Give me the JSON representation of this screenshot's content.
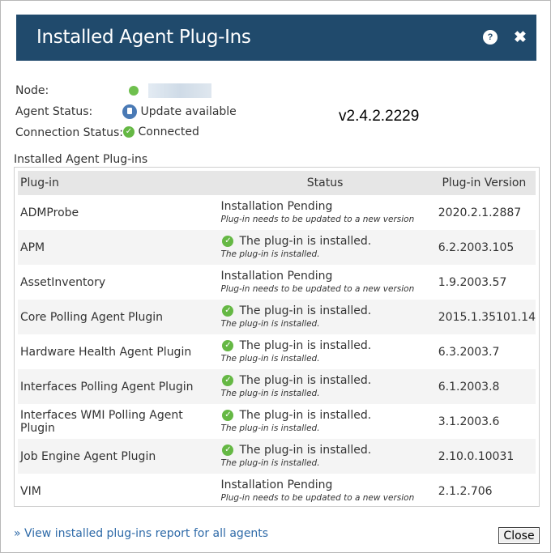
{
  "dialog": {
    "title": "Installed Agent Plug-Ins",
    "help_icon": "question-circle-icon",
    "close_icon": "close-x-icon"
  },
  "info": {
    "node_label": "Node:",
    "agent_status_label": "Agent Status:",
    "agent_status_value": "Update available",
    "connection_status_label": "Connection Status:",
    "connection_status_value": "Connected"
  },
  "version_text": "v2.4.2.2229",
  "section_title": "Installed Agent Plug-ins",
  "table": {
    "headers": [
      "Plug-in",
      "Status",
      "Plug-in Version"
    ],
    "rows": [
      {
        "plugin": "ADMProbe",
        "status": "Installation Pending",
        "status_sub": "Plug-in needs to be updated to a new version",
        "installed": false,
        "version": "2020.2.1.2887"
      },
      {
        "plugin": "APM",
        "status": "The plug-in is installed.",
        "status_sub": "The plug-in is installed.",
        "installed": true,
        "version": "6.2.2003.105"
      },
      {
        "plugin": "AssetInventory",
        "status": "Installation Pending",
        "status_sub": "Plug-in needs to be updated to a new version",
        "installed": false,
        "version": "1.9.2003.57"
      },
      {
        "plugin": "Core Polling Agent Plugin",
        "status": "The plug-in is installed.",
        "status_sub": "The plug-in is installed.",
        "installed": true,
        "version": "2015.1.35101.14"
      },
      {
        "plugin": "Hardware Health Agent Plugin",
        "status": "The plug-in is installed.",
        "status_sub": "The plug-in is installed.",
        "installed": true,
        "version": "6.3.2003.7"
      },
      {
        "plugin": "Interfaces Polling Agent Plugin",
        "status": "The plug-in is installed.",
        "status_sub": "The plug-in is installed.",
        "installed": true,
        "version": "6.1.2003.8"
      },
      {
        "plugin": "Interfaces WMI Polling Agent Plugin",
        "status": "The plug-in is installed.",
        "status_sub": "The plug-in is installed.",
        "installed": true,
        "version": "3.1.2003.6"
      },
      {
        "plugin": "Job Engine Agent Plugin",
        "status": "The plug-in is installed.",
        "status_sub": "The plug-in is installed.",
        "installed": true,
        "version": "2.10.0.10031"
      },
      {
        "plugin": "VIM",
        "status": "Installation Pending",
        "status_sub": "Plug-in needs to be updated to a new version",
        "installed": false,
        "version": "2.1.2.706"
      }
    ]
  },
  "footer": {
    "report_link": "» View installed plug-ins report for all agents",
    "close_button": "Close"
  },
  "colors": {
    "titlebar": "#204a6c",
    "success": "#65b844",
    "link": "#2e6aa8"
  }
}
